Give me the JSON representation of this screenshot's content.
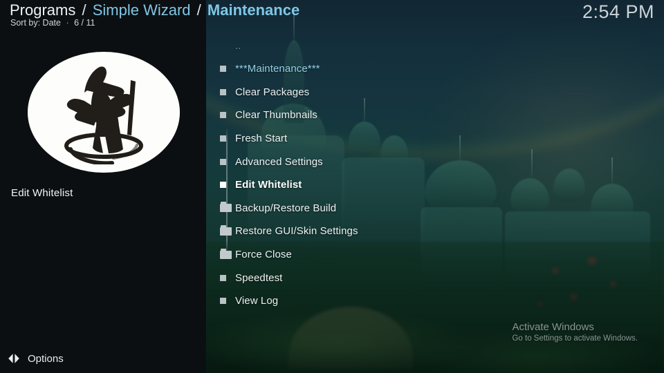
{
  "header": {
    "breadcrumb": {
      "root": "Programs",
      "separator": "/",
      "parent": "Simple Wizard",
      "current": "Maintenance"
    },
    "sort_label": "Sort by: Date",
    "separator_dot": "·",
    "position": "6 / 11",
    "clock": "2:54 PM"
  },
  "sidebar": {
    "logo_name": "simple-wizard-logo",
    "selected_item_label": "Edit Whitelist"
  },
  "list": {
    "parent_item": {
      "label": "..",
      "icon": "parent-directory"
    },
    "items": [
      {
        "label": "***Maintenance***",
        "icon": "file-icon",
        "selected": false,
        "accent": true
      },
      {
        "label": "Clear Packages",
        "icon": "file-icon",
        "selected": false,
        "accent": false
      },
      {
        "label": "Clear Thumbnails",
        "icon": "file-icon",
        "selected": false,
        "accent": false
      },
      {
        "label": "Fresh Start",
        "icon": "file-icon",
        "selected": false,
        "accent": false
      },
      {
        "label": "Advanced Settings",
        "icon": "file-icon",
        "selected": false,
        "accent": false
      },
      {
        "label": "Edit Whitelist",
        "icon": "file-icon",
        "selected": true,
        "accent": false
      },
      {
        "label": "Backup/Restore Build",
        "icon": "folder-icon",
        "selected": false,
        "accent": false
      },
      {
        "label": "Restore GUI/Skin Settings",
        "icon": "folder-icon",
        "selected": false,
        "accent": false
      },
      {
        "label": "Force Close",
        "icon": "folder-icon",
        "selected": false,
        "accent": false
      },
      {
        "label": "Speedtest",
        "icon": "file-icon",
        "selected": false,
        "accent": false
      },
      {
        "label": "View Log",
        "icon": "file-icon",
        "selected": false,
        "accent": false
      }
    ]
  },
  "watermark": {
    "title": "Activate Windows",
    "subtitle": "Go to Settings to activate Windows."
  },
  "bottom_bar": {
    "options_label": "Options",
    "options_icon": "left-right-arrows-icon"
  },
  "colors": {
    "accent_blue": "#7fc7e6",
    "text_primary": "#eef1f3",
    "text_selected": "#ffffff",
    "sidebar_bg": "#0c0f11",
    "icon_gray": "#c2cacd"
  }
}
